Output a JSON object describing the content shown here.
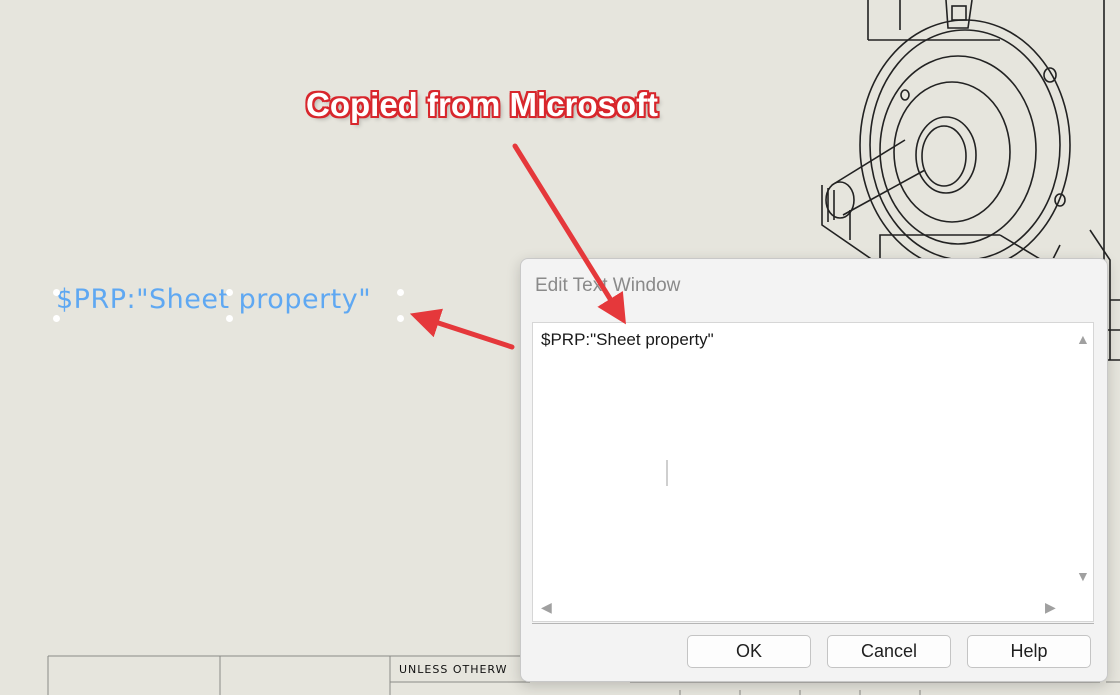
{
  "sheet_note": {
    "text": "$PRP:\"Sheet property\"",
    "color": "#5fa8f2"
  },
  "annotation": {
    "label": "Copied from Microsoft",
    "arrow_color": "#e5383b"
  },
  "title_block": {
    "text": "UNLESS OTHERW"
  },
  "dialog": {
    "title": "Edit Text Window",
    "content": "$PRP:\"Sheet property\"",
    "buttons": {
      "ok": "OK",
      "cancel": "Cancel",
      "help": "Help"
    }
  },
  "icons": {
    "scroll_up": "scroll-up-arrow-icon",
    "scroll_down": "scroll-down-arrow-icon",
    "scroll_left": "scroll-left-arrow-icon",
    "scroll_right": "scroll-right-arrow-icon"
  }
}
